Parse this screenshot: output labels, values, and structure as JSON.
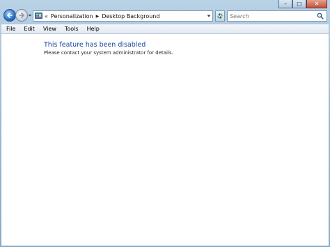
{
  "window": {
    "caption_buttons": {
      "minimize": "–",
      "maximize": "□",
      "close": "✕"
    }
  },
  "navigation": {
    "back_icon": "back-arrow-icon",
    "forward_icon": "forward-arrow-icon",
    "address": {
      "icon": "control-panel-icon",
      "chevrons": "«",
      "breadcrumbs": [
        "Personalization",
        "Desktop Background"
      ],
      "separator": "▶"
    },
    "refresh_icon": "refresh-icon",
    "search": {
      "placeholder": "Search",
      "icon": "search-icon"
    }
  },
  "menu": {
    "items": [
      "File",
      "Edit",
      "View",
      "Tools",
      "Help"
    ]
  },
  "main": {
    "title": "This feature has been disabled",
    "body": "Please contact your system administrator for details."
  },
  "colors": {
    "title_blue": "#1b47a3",
    "window_frame": "#9dbbd6",
    "content_bg": "#ffffff"
  }
}
